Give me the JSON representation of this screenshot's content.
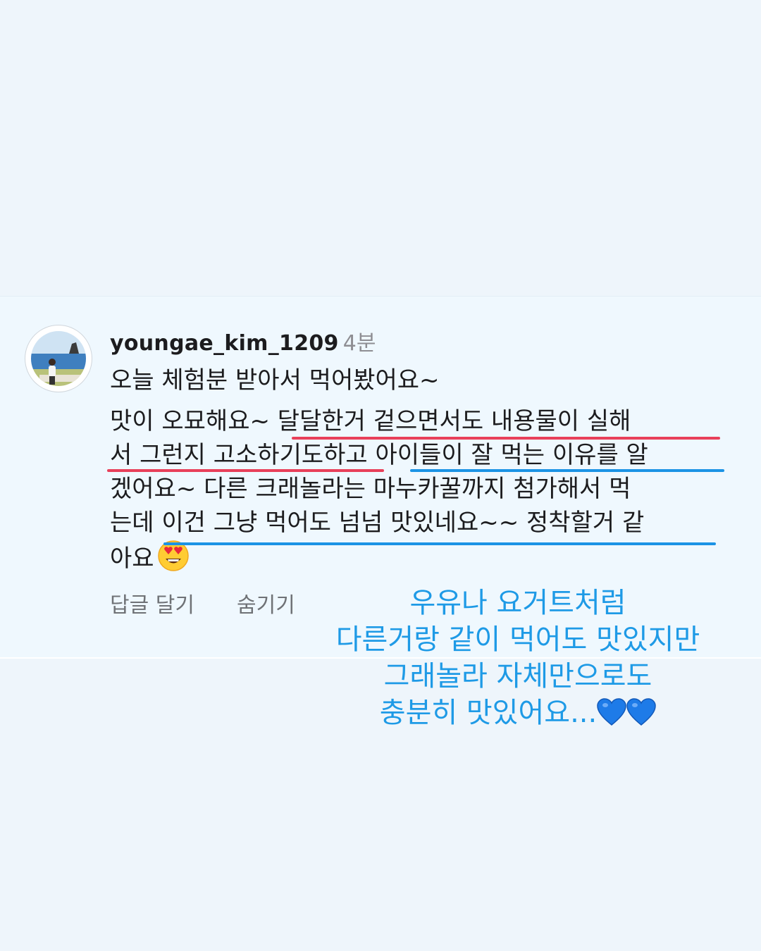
{
  "comment": {
    "username": "youngae_kim_1209",
    "time": "4분",
    "intro": "오늘 체험분 받아서 먹어봤어요~",
    "body_lines": [
      "맛이 오묘해요~ 달달한거 겉으면서도 내용물이 실해",
      "서 그런지 고소하기도하고 아이들이 잘 먹는 이유를 알",
      "겠어요~ 다른 크래놀라는 마누카꿀까지 첨가해서 먹",
      "는데 이건 그냥 먹어도 넘넘 맛있네요~~ 정착할거 같",
      "아요"
    ],
    "emoji": "smiling-face-with-heart-eyes",
    "reply_label": "답글 달기",
    "hide_label": "숨기기"
  },
  "caption": {
    "lines": [
      "우유나 요거트처럼",
      "다른거랑 같이 먹어도 맛있지만",
      "그래놀라 자체만으로도",
      "충분히 맛있어요..."
    ],
    "heart_emoji": "blue-heart"
  },
  "colors": {
    "background": "#eef5fb",
    "card": "#eff8fe",
    "underline_red": "#e8405a",
    "underline_blue": "#1b93e5",
    "caption_text": "#1e9ae6"
  }
}
